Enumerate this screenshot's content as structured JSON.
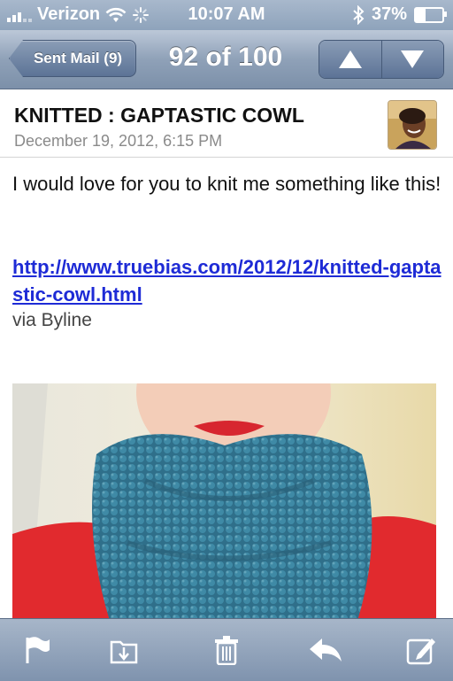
{
  "status_bar": {
    "carrier": "Verizon",
    "time": "10:07 AM",
    "battery": "37%",
    "battery_level": 0.37
  },
  "nav": {
    "back_label": "Sent Mail (9)",
    "title": "92 of 100"
  },
  "message": {
    "subject": "KNITTED : GAPTASTIC COWL",
    "date": "December 19, 2012, 6:15 PM",
    "body": "I would love for you to knit me something like this!",
    "link": "http://www.truebias.com/2012/12/knitted-gaptastic-cowl.html",
    "via": "via Byline"
  },
  "toolbar": {
    "icons": [
      "flag-icon",
      "move-folder-icon",
      "trash-icon",
      "reply-icon",
      "compose-icon"
    ]
  },
  "colors": {
    "link": "#1e2bd6",
    "nav_bar": "#8fa1b8"
  }
}
